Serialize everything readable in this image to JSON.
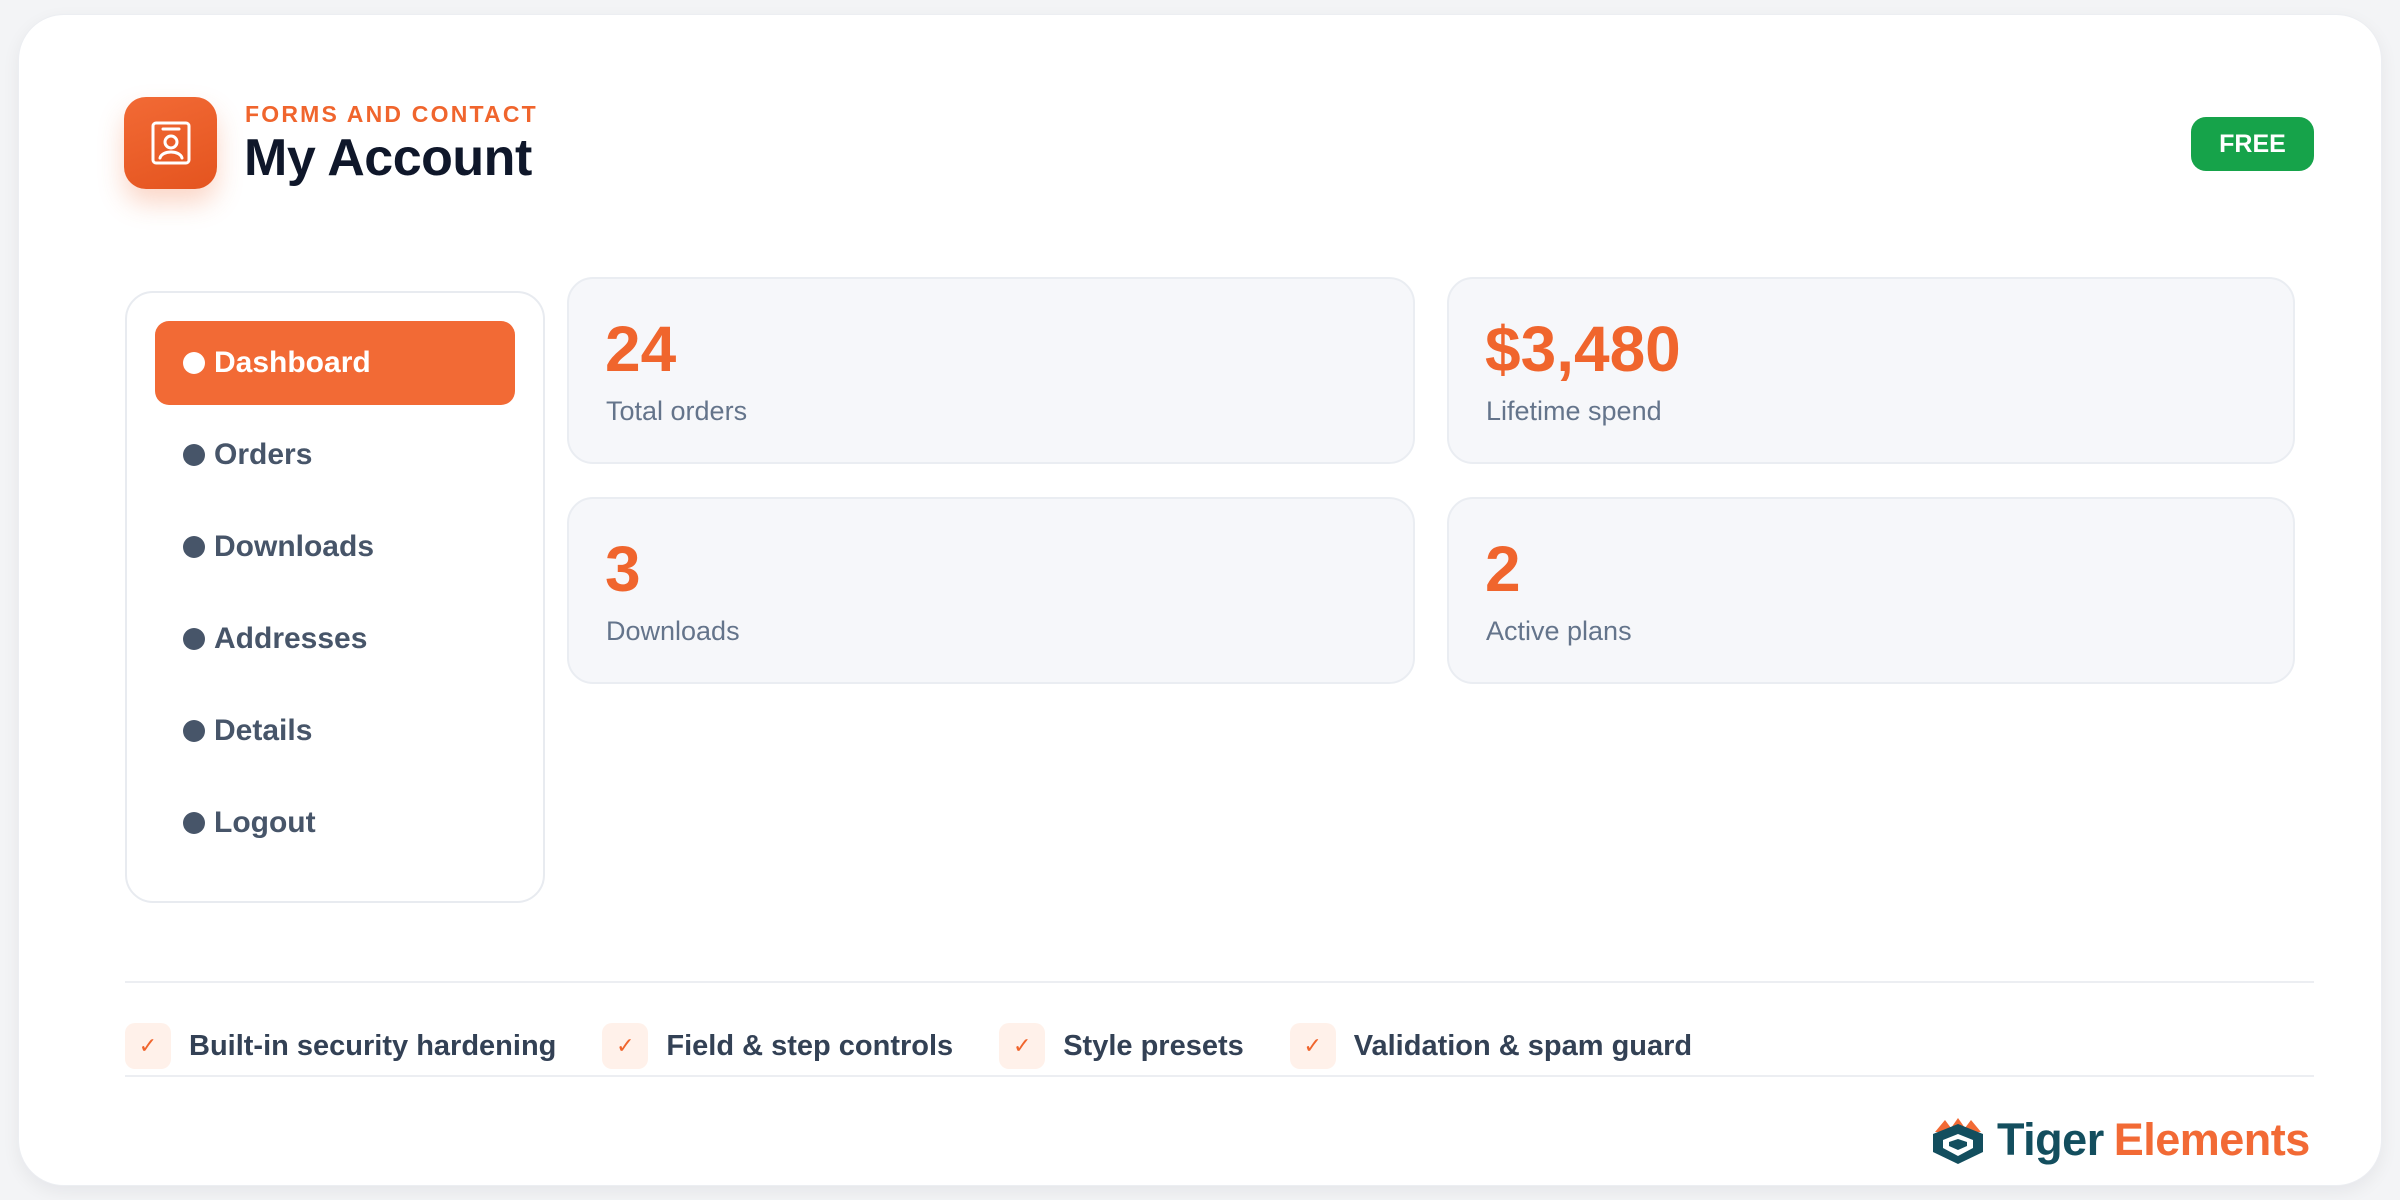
{
  "header": {
    "eyebrow": "FORMS AND CONTACT",
    "title": "My Account",
    "badge": "FREE",
    "icon": "contact-card-icon"
  },
  "sidebar": {
    "items": [
      {
        "label": "Dashboard",
        "active": true
      },
      {
        "label": "Orders",
        "active": false
      },
      {
        "label": "Downloads",
        "active": false
      },
      {
        "label": "Addresses",
        "active": false
      },
      {
        "label": "Details",
        "active": false
      },
      {
        "label": "Logout",
        "active": false
      }
    ]
  },
  "stats": [
    {
      "value": "24",
      "label": "Total orders"
    },
    {
      "value": "$3,480",
      "label": "Lifetime spend"
    },
    {
      "value": "3",
      "label": "Downloads"
    },
    {
      "value": "2",
      "label": "Active plans"
    }
  ],
  "features": [
    {
      "check": "✓",
      "label": "Built-in security hardening"
    },
    {
      "check": "✓",
      "label": "Field & step controls"
    },
    {
      "check": "✓",
      "label": "Style presets"
    },
    {
      "check": "✓",
      "label": "Validation & spam guard"
    }
  ],
  "brand": {
    "word1": "Tiger",
    "word2": "Elements",
    "icon": "tiger-logo-icon"
  },
  "colors": {
    "accent": "#f26a35",
    "badge": "#16a34a",
    "title": "#0f172a",
    "nav_text": "#475569",
    "brand_dark": "#134e5e"
  }
}
